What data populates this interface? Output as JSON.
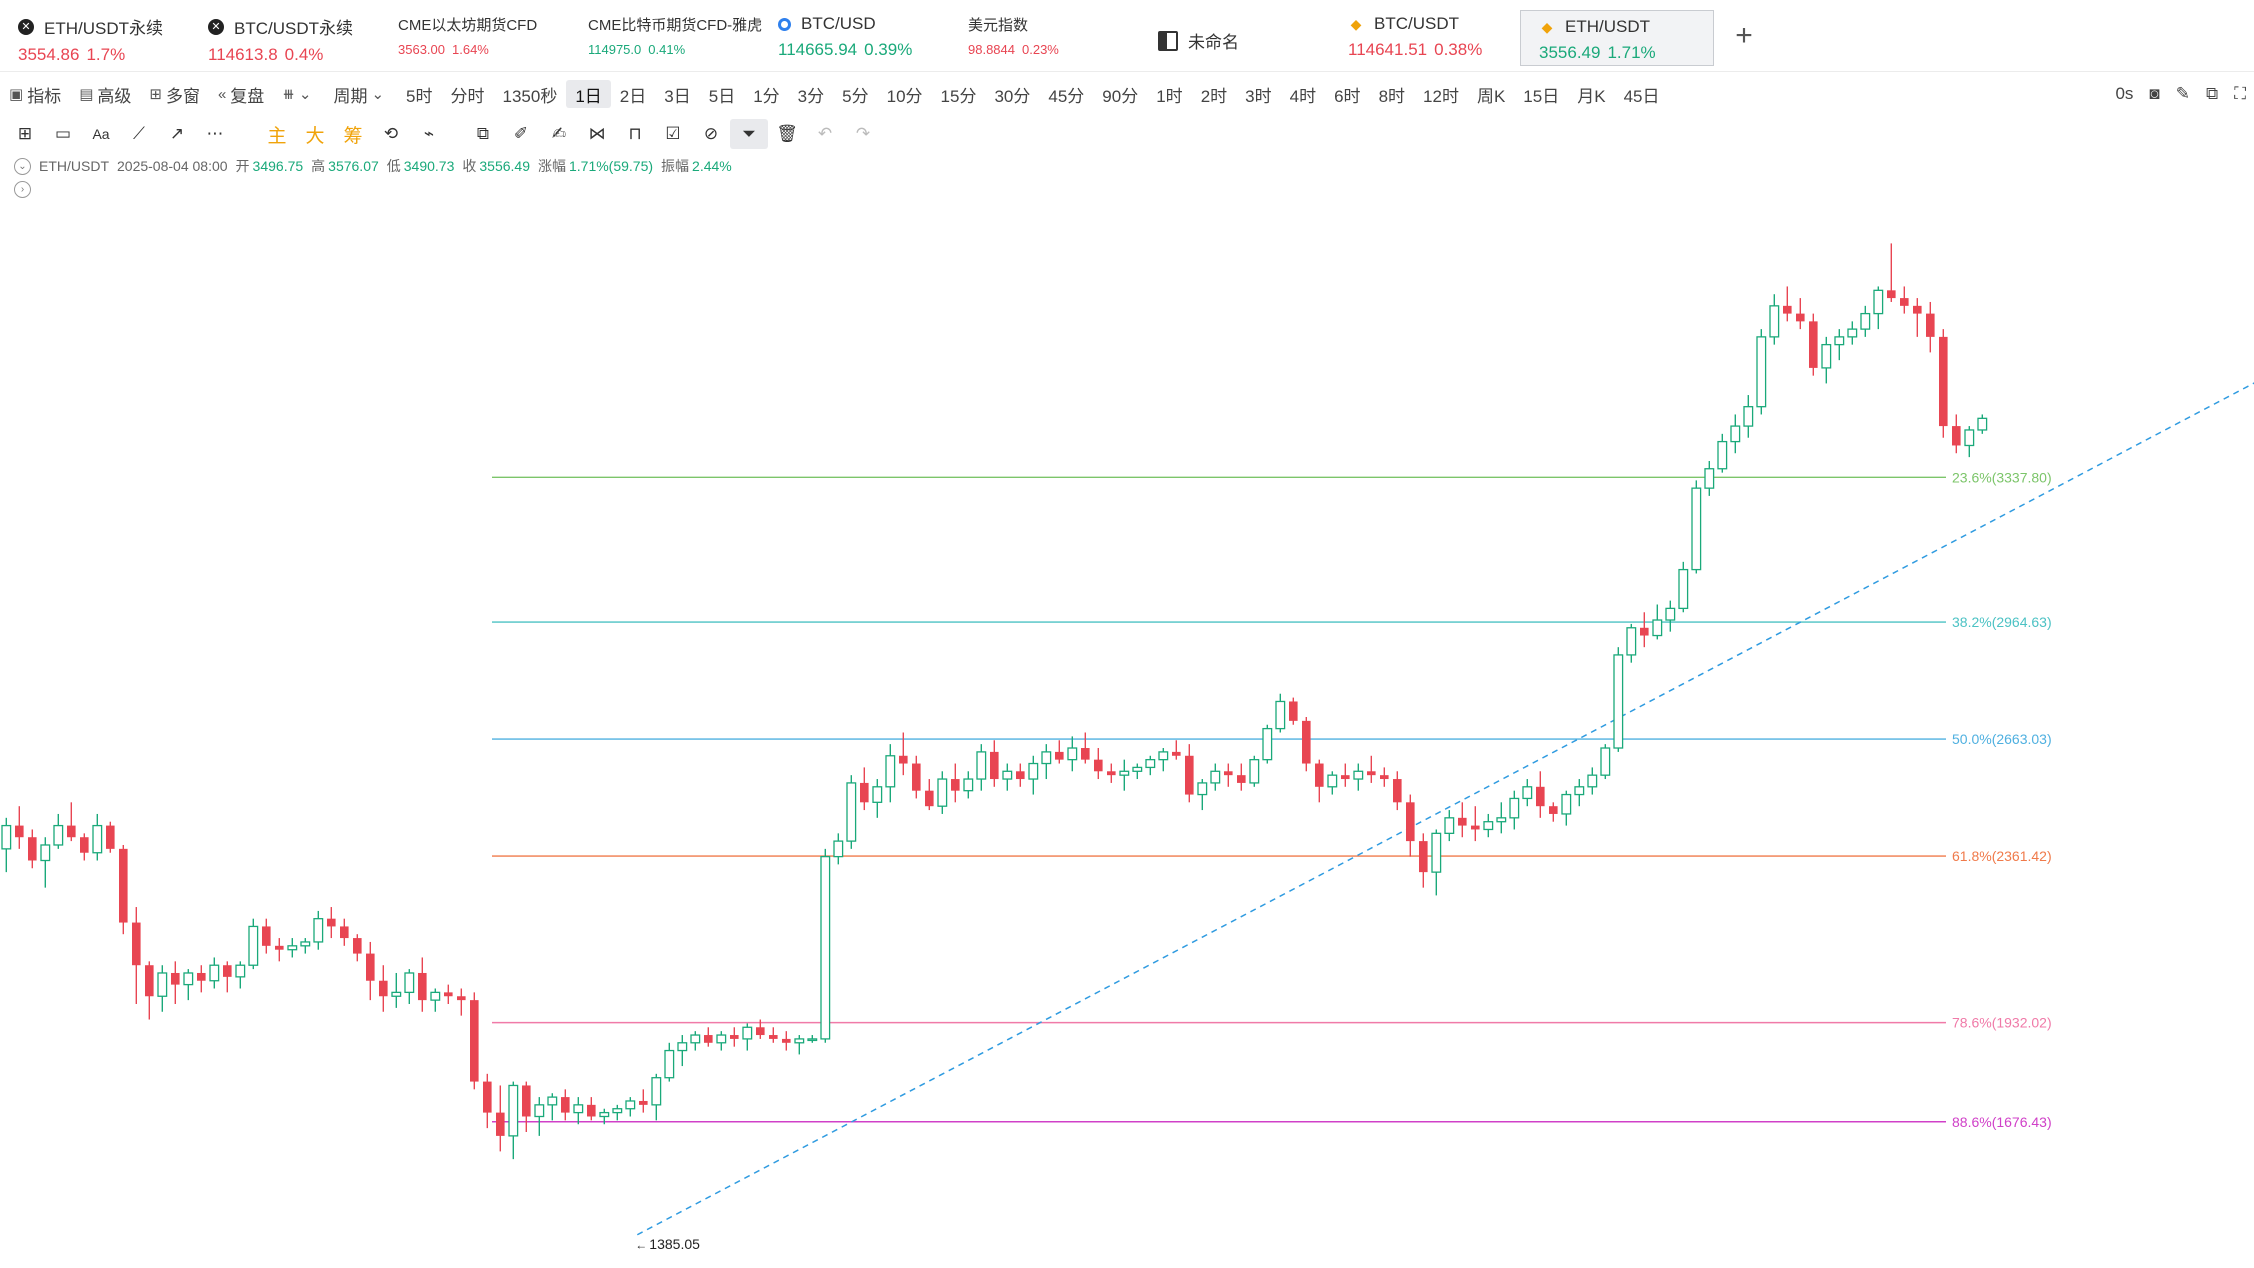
{
  "tabs": [
    {
      "icon": "x-icon",
      "name": "ETH/USDT永续",
      "price": "3554.86",
      "change": "1.7%",
      "color": "red",
      "size": "normal"
    },
    {
      "icon": "x-icon",
      "name": "BTC/USDT永续",
      "price": "114613.8",
      "change": "0.4%",
      "color": "red",
      "size": "normal"
    },
    {
      "icon": "",
      "name": "CME以太坊期货CFD",
      "price": "3563.00",
      "change": "1.64%",
      "color": "red",
      "size": "small"
    },
    {
      "icon": "",
      "name": "CME比特币期货CFD-雅虎",
      "price": "114975.0",
      "change": "0.41%",
      "color": "green",
      "size": "small"
    },
    {
      "icon": "blue-circle-icon",
      "name": "BTC/USD",
      "price": "114665.94",
      "change": "0.39%",
      "color": "green",
      "size": "normal"
    },
    {
      "icon": "",
      "name": "美元指数",
      "price": "98.8844",
      "change": "0.23%",
      "color": "red",
      "size": "small"
    },
    {
      "icon": "book-icon",
      "name": "未命名",
      "price": "",
      "change": "",
      "color": "",
      "size": "book"
    },
    {
      "icon": "diamond-icon",
      "name": "BTC/USDT",
      "price": "114641.51",
      "change": "0.38%",
      "color": "red",
      "size": "normal"
    },
    {
      "icon": "diamond-icon",
      "name": "ETH/USDT",
      "price": "3556.49",
      "change": "1.71%",
      "color": "green",
      "size": "normal",
      "active": true
    }
  ],
  "add_tab": "+",
  "toolbar": {
    "indicators": "指标",
    "advanced": "高级",
    "multi_window": "多窗",
    "replay": "复盘",
    "period": "周期",
    "intervals": [
      "5时",
      "分时",
      "1350秒",
      "1日",
      "2日",
      "3日",
      "5日",
      "1分",
      "3分",
      "5分",
      "10分",
      "15分",
      "30分",
      "45分",
      "90分",
      "1时",
      "2时",
      "3时",
      "4时",
      "6时",
      "8时",
      "12时",
      "周K",
      "15日",
      "月K",
      "45日"
    ],
    "selected_interval": "1日",
    "right_label": "0s"
  },
  "draw_tools": {
    "main": "主",
    "big": "大",
    "chips": "筹"
  },
  "legend": {
    "symbol": "ETH/USDT",
    "datetime": "2025-08-04 08:00",
    "open_label": "开",
    "open": "3496.75",
    "high_label": "高",
    "high": "3576.07",
    "low_label": "低",
    "low": "3490.73",
    "close_label": "收",
    "close": "3556.49",
    "change_label": "涨幅",
    "change": "1.71%(59.75)",
    "amp_label": "振幅",
    "amp": "2.44%"
  },
  "colors": {
    "up": "#1aa97a",
    "down": "#e84552",
    "trend": "#2f9be0"
  },
  "chart_data": {
    "type": "candlestick",
    "price_range": [
      1320,
      4040
    ],
    "fib_levels": [
      {
        "label": "23.6%(3337.80)",
        "value": 3337.8,
        "color": "#7cc56a"
      },
      {
        "label": "38.2%(2964.63)",
        "value": 2964.63,
        "color": "#4cc2c4"
      },
      {
        "label": "50.0%(2663.03)",
        "value": 2663.03,
        "color": "#4fb0e0"
      },
      {
        "label": "61.8%(2361.42)",
        "value": 2361.42,
        "color": "#f07a4a"
      },
      {
        "label": "78.6%(1932.02)",
        "value": 1932.02,
        "color": "#f07aa8"
      },
      {
        "label": "88.6%(1676.43)",
        "value": 1676.43,
        "color": "#d040c8"
      }
    ],
    "high_marker": "3941.00",
    "low_marker": "1385.05",
    "trend_from": {
      "index": 49,
      "price": 1385.05
    },
    "trend_to": {
      "index": 193,
      "price": 3941.0
    },
    "candles": [
      [
        2380,
        2460,
        2320,
        2440
      ],
      [
        2440,
        2490,
        2380,
        2410
      ],
      [
        2410,
        2430,
        2330,
        2350
      ],
      [
        2350,
        2410,
        2280,
        2390
      ],
      [
        2390,
        2470,
        2380,
        2440
      ],
      [
        2440,
        2500,
        2400,
        2410
      ],
      [
        2410,
        2420,
        2350,
        2370
      ],
      [
        2370,
        2470,
        2350,
        2440
      ],
      [
        2440,
        2450,
        2370,
        2380
      ],
      [
        2380,
        2390,
        2160,
        2190
      ],
      [
        2190,
        2230,
        1980,
        2080
      ],
      [
        2080,
        2090,
        1940,
        2000
      ],
      [
        2000,
        2080,
        1960,
        2060
      ],
      [
        2060,
        2090,
        1980,
        2030
      ],
      [
        2030,
        2070,
        1990,
        2060
      ],
      [
        2060,
        2080,
        2010,
        2040
      ],
      [
        2040,
        2100,
        2020,
        2080
      ],
      [
        2080,
        2090,
        2010,
        2050
      ],
      [
        2050,
        2090,
        2020,
        2080
      ],
      [
        2080,
        2200,
        2070,
        2180
      ],
      [
        2180,
        2200,
        2110,
        2130
      ],
      [
        2130,
        2150,
        2090,
        2120
      ],
      [
        2120,
        2150,
        2100,
        2130
      ],
      [
        2130,
        2150,
        2110,
        2140
      ],
      [
        2140,
        2220,
        2120,
        2200
      ],
      [
        2200,
        2230,
        2150,
        2180
      ],
      [
        2180,
        2200,
        2130,
        2150
      ],
      [
        2150,
        2160,
        2090,
        2110
      ],
      [
        2110,
        2140,
        1990,
        2040
      ],
      [
        2040,
        2080,
        1960,
        2000
      ],
      [
        2000,
        2060,
        1970,
        2010
      ],
      [
        2010,
        2070,
        1980,
        2060
      ],
      [
        2060,
        2100,
        1960,
        1990
      ],
      [
        1990,
        2020,
        1960,
        2010
      ],
      [
        2010,
        2030,
        1980,
        2000
      ],
      [
        2000,
        2020,
        1950,
        1990
      ],
      [
        1990,
        2010,
        1760,
        1780
      ],
      [
        1780,
        1800,
        1660,
        1700
      ],
      [
        1700,
        1770,
        1600,
        1640
      ],
      [
        1640,
        1780,
        1580,
        1770
      ],
      [
        1770,
        1780,
        1650,
        1690
      ],
      [
        1690,
        1740,
        1640,
        1720
      ],
      [
        1720,
        1750,
        1680,
        1740
      ],
      [
        1740,
        1760,
        1680,
        1700
      ],
      [
        1700,
        1740,
        1670,
        1720
      ],
      [
        1720,
        1740,
        1680,
        1690
      ],
      [
        1690,
        1710,
        1670,
        1700
      ],
      [
        1700,
        1720,
        1680,
        1710
      ],
      [
        1710,
        1740,
        1690,
        1730
      ],
      [
        1730,
        1760,
        1700,
        1720
      ],
      [
        1720,
        1800,
        1680,
        1790
      ],
      [
        1790,
        1880,
        1780,
        1860
      ],
      [
        1860,
        1900,
        1820,
        1880
      ],
      [
        1880,
        1910,
        1860,
        1900
      ],
      [
        1900,
        1920,
        1870,
        1880
      ],
      [
        1880,
        1910,
        1860,
        1900
      ],
      [
        1900,
        1920,
        1870,
        1890
      ],
      [
        1890,
        1930,
        1860,
        1920
      ],
      [
        1920,
        1940,
        1890,
        1900
      ],
      [
        1900,
        1920,
        1880,
        1890
      ],
      [
        1890,
        1910,
        1860,
        1880
      ],
      [
        1880,
        1900,
        1850,
        1890
      ],
      [
        1890,
        1900,
        1880,
        1890
      ],
      [
        1890,
        2380,
        1880,
        2360
      ],
      [
        2360,
        2420,
        2340,
        2400
      ],
      [
        2400,
        2570,
        2380,
        2550
      ],
      [
        2550,
        2590,
        2480,
        2500
      ],
      [
        2500,
        2560,
        2460,
        2540
      ],
      [
        2540,
        2650,
        2500,
        2620
      ],
      [
        2620,
        2680,
        2570,
        2600
      ],
      [
        2600,
        2620,
        2510,
        2530
      ],
      [
        2530,
        2560,
        2480,
        2490
      ],
      [
        2490,
        2580,
        2470,
        2560
      ],
      [
        2560,
        2600,
        2500,
        2530
      ],
      [
        2530,
        2580,
        2510,
        2560
      ],
      [
        2560,
        2650,
        2530,
        2630
      ],
      [
        2630,
        2660,
        2540,
        2560
      ],
      [
        2560,
        2600,
        2530,
        2580
      ],
      [
        2580,
        2600,
        2540,
        2560
      ],
      [
        2560,
        2620,
        2520,
        2600
      ],
      [
        2600,
        2650,
        2560,
        2630
      ],
      [
        2630,
        2660,
        2600,
        2610
      ],
      [
        2610,
        2670,
        2580,
        2640
      ],
      [
        2640,
        2680,
        2600,
        2610
      ],
      [
        2610,
        2640,
        2560,
        2580
      ],
      [
        2580,
        2600,
        2550,
        2570
      ],
      [
        2570,
        2610,
        2530,
        2580
      ],
      [
        2580,
        2600,
        2560,
        2590
      ],
      [
        2590,
        2620,
        2570,
        2610
      ],
      [
        2610,
        2640,
        2580,
        2630
      ],
      [
        2630,
        2660,
        2610,
        2620
      ],
      [
        2620,
        2650,
        2500,
        2520
      ],
      [
        2520,
        2560,
        2480,
        2550
      ],
      [
        2550,
        2600,
        2530,
        2580
      ],
      [
        2580,
        2600,
        2540,
        2570
      ],
      [
        2570,
        2600,
        2530,
        2550
      ],
      [
        2550,
        2620,
        2540,
        2610
      ],
      [
        2610,
        2700,
        2600,
        2690
      ],
      [
        2690,
        2780,
        2680,
        2760
      ],
      [
        2760,
        2770,
        2700,
        2710
      ],
      [
        2710,
        2720,
        2580,
        2600
      ],
      [
        2600,
        2610,
        2500,
        2540
      ],
      [
        2540,
        2580,
        2520,
        2570
      ],
      [
        2570,
        2600,
        2540,
        2560
      ],
      [
        2560,
        2600,
        2530,
        2580
      ],
      [
        2580,
        2620,
        2550,
        2570
      ],
      [
        2570,
        2590,
        2540,
        2560
      ],
      [
        2560,
        2580,
        2480,
        2500
      ],
      [
        2500,
        2520,
        2360,
        2400
      ],
      [
        2400,
        2420,
        2280,
        2320
      ],
      [
        2320,
        2430,
        2260,
        2420
      ],
      [
        2420,
        2480,
        2400,
        2460
      ],
      [
        2460,
        2500,
        2410,
        2440
      ],
      [
        2440,
        2490,
        2400,
        2430
      ],
      [
        2430,
        2470,
        2410,
        2450
      ],
      [
        2450,
        2500,
        2420,
        2460
      ],
      [
        2460,
        2530,
        2430,
        2510
      ],
      [
        2510,
        2560,
        2490,
        2540
      ],
      [
        2540,
        2580,
        2460,
        2490
      ],
      [
        2490,
        2500,
        2450,
        2470
      ],
      [
        2470,
        2530,
        2440,
        2520
      ],
      [
        2520,
        2560,
        2490,
        2540
      ],
      [
        2540,
        2590,
        2520,
        2570
      ],
      [
        2570,
        2650,
        2560,
        2640
      ],
      [
        2640,
        2900,
        2630,
        2880
      ],
      [
        2880,
        2960,
        2860,
        2950
      ],
      [
        2950,
        2990,
        2900,
        2930
      ],
      [
        2930,
        3010,
        2920,
        2970
      ],
      [
        2970,
        3020,
        2940,
        3000
      ],
      [
        3000,
        3120,
        2990,
        3100
      ],
      [
        3100,
        3330,
        3090,
        3310
      ],
      [
        3310,
        3380,
        3290,
        3360
      ],
      [
        3360,
        3450,
        3350,
        3430
      ],
      [
        3430,
        3500,
        3400,
        3470
      ],
      [
        3470,
        3550,
        3440,
        3520
      ],
      [
        3520,
        3720,
        3500,
        3700
      ],
      [
        3700,
        3810,
        3680,
        3780
      ],
      [
        3780,
        3830,
        3740,
        3760
      ],
      [
        3760,
        3800,
        3720,
        3740
      ],
      [
        3740,
        3760,
        3600,
        3620
      ],
      [
        3620,
        3700,
        3580,
        3680
      ],
      [
        3680,
        3720,
        3640,
        3700
      ],
      [
        3700,
        3740,
        3680,
        3720
      ],
      [
        3720,
        3780,
        3700,
        3760
      ],
      [
        3760,
        3830,
        3720,
        3820
      ],
      [
        3820,
        3941,
        3790,
        3800
      ],
      [
        3800,
        3830,
        3760,
        3780
      ],
      [
        3780,
        3800,
        3700,
        3760
      ],
      [
        3760,
        3790,
        3660,
        3700
      ],
      [
        3700,
        3720,
        3440,
        3470
      ],
      [
        3470,
        3500,
        3400,
        3420
      ],
      [
        3420,
        3470,
        3390,
        3460
      ],
      [
        3460,
        3500,
        3450,
        3490
      ]
    ]
  }
}
